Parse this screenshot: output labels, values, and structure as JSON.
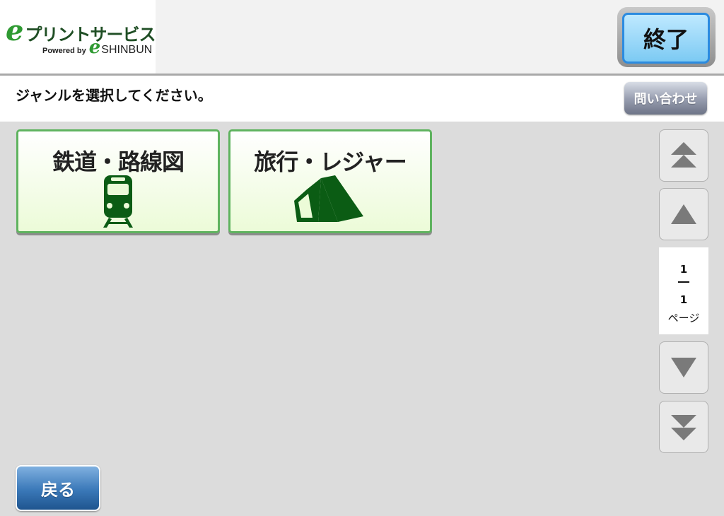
{
  "header": {
    "logo": {
      "e_letter": "e",
      "service_name": "プリントサービス",
      "powered_by": "Powered by",
      "powered_e": "e",
      "brand": "SHINBUN"
    },
    "end_button": "終了"
  },
  "instruction": {
    "text": "ジャンルを選択してください。",
    "inquiry_button": "問い合わせ"
  },
  "categories": [
    {
      "label": "鉄道・路線図",
      "icon": "train-icon"
    },
    {
      "label": "旅行・レジャー",
      "icon": "tent-icon"
    }
  ],
  "pager": {
    "current_page": "1",
    "total_pages": "1",
    "unit": "ページ"
  },
  "footer": {
    "back_button": "戻る"
  },
  "colors": {
    "accent_green": "#2f9a32",
    "tile_border": "#5fb35f",
    "icon_green": "#0b5c14",
    "end_button_blue": "#7ccaf3",
    "back_button_blue": "#3a78b8",
    "pager_arrow": "#7a7a7a"
  }
}
